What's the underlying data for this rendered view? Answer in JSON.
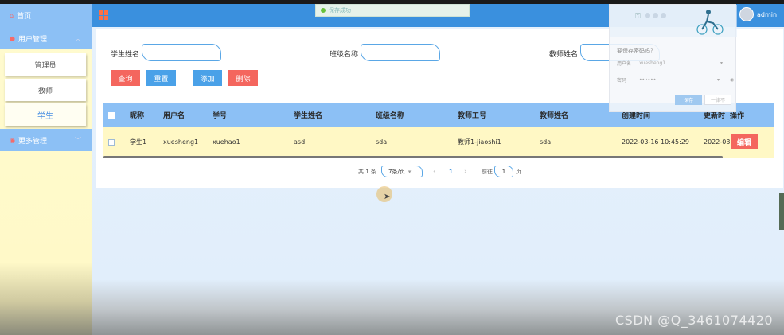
{
  "sidebar": {
    "home": "首页",
    "user_mgmt": "用户管理",
    "items": [
      {
        "label": "管理员"
      },
      {
        "label": "教师"
      },
      {
        "label": "学生"
      }
    ],
    "more_mgmt": "更多管理"
  },
  "topbar": {
    "toast": "保存成功",
    "user": "admin"
  },
  "search": {
    "student_name_label": "学生姓名",
    "class_name_label": "班级名称",
    "teacher_name_label": "教师姓名"
  },
  "buttons": {
    "query": "查询",
    "reset": "重置",
    "add": "添加",
    "delete": "删除"
  },
  "table": {
    "headers": [
      "昵称",
      "用户名",
      "学号",
      "学生姓名",
      "班级名称",
      "教师工号",
      "教师姓名",
      "创建时间",
      "更新时",
      "操作"
    ],
    "rows": [
      [
        "学生1",
        "xuesheng1",
        "xuehao1",
        "asd",
        "sda",
        "教师1-jiaoshi1",
        "sda",
        "2022-03-16 10:45:29",
        "2022-03",
        "编辑"
      ]
    ]
  },
  "pagination": {
    "total": "共 1 条",
    "page_size": "7条/页",
    "prev": "‹",
    "current": "1",
    "next": "›",
    "goto_prefix": "前往",
    "goto_value": "1",
    "goto_suffix": "页"
  },
  "password_popup": {
    "title": "要保存密码吗？",
    "username_label": "用户名",
    "username_value": "xuesheng1",
    "password_label": "密码",
    "password_value": "••••••",
    "save": "保存",
    "never": "一律不"
  },
  "watermark": "CSDN @Q_3461074420",
  "colors": {
    "sidebar_bg": "#fffbd0",
    "header_blue": "#3a90de",
    "menu_blue": "#8cc0f5",
    "red_button": "#f4665e",
    "blue_button": "#4aa1e8",
    "row_yellow": "#fff8c5"
  }
}
